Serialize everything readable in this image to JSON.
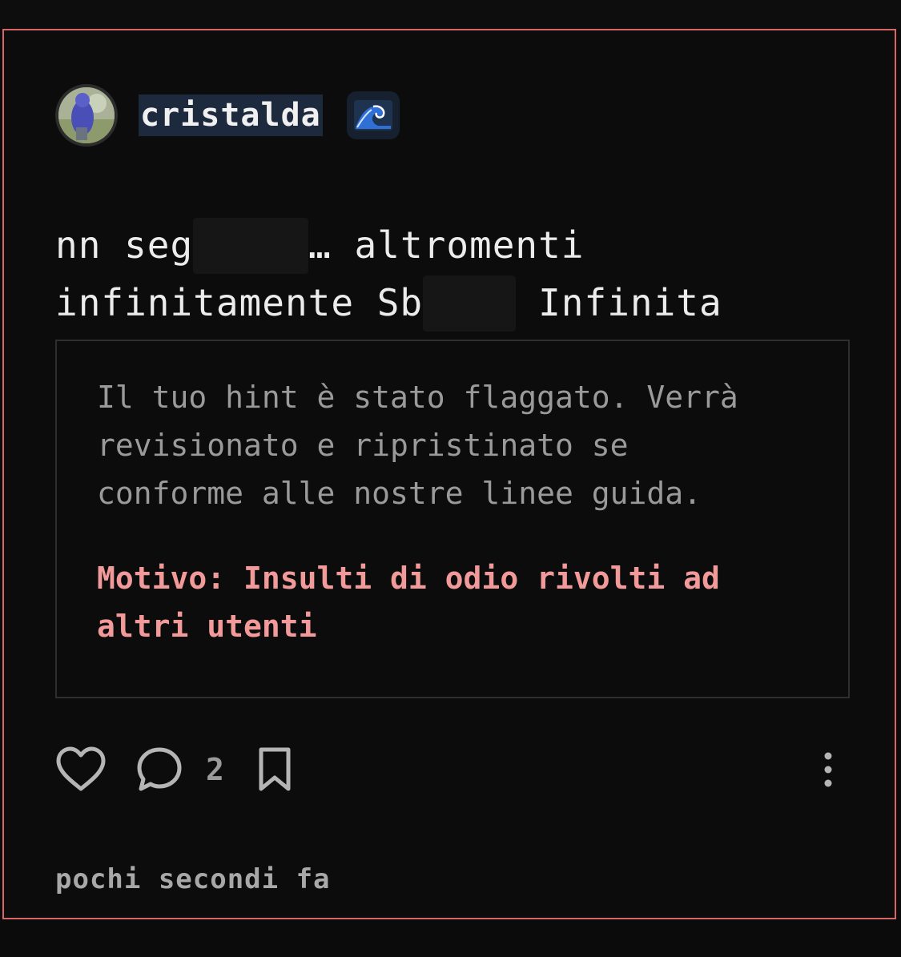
{
  "post": {
    "author": {
      "username": "cristalda",
      "avatar_icon": "user-avatar-photo",
      "badge_icon": "wave-emoji-icon"
    },
    "text_lines": [
      {
        "before": "nn seg",
        "after": "… altromenti"
      },
      {
        "before": "infinitamente Sb",
        "after": "Infinita"
      }
    ],
    "moderation_notice": {
      "message": "Il tuo hint è stato flaggato. Verrà\nrevisionato e ripristinato se\nconforme alle nostre linee guida.",
      "reason": "Motivo: Insulti di odio rivolti ad\naltri utenti"
    },
    "actions": {
      "like_icon": "heart-icon",
      "comment_icon": "comment-bubble-icon",
      "comment_count": "2",
      "bookmark_icon": "bookmark-icon",
      "more_icon": "more-vertical-icon"
    },
    "timestamp": "pochi secondi fa"
  },
  "colors": {
    "card_border": "#d96666",
    "reason_text": "#f29a9a",
    "username_highlight": "#1d2a3d"
  }
}
